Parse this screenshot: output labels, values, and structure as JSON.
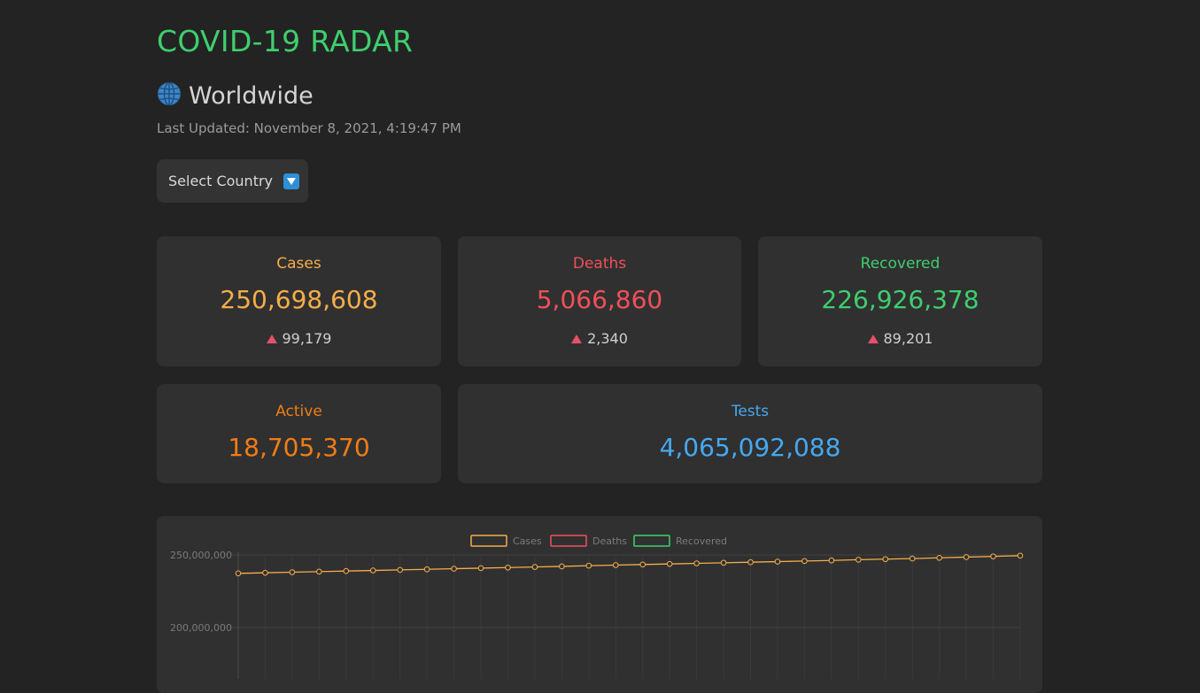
{
  "app": {
    "title": "COVID-19 RADAR"
  },
  "region": {
    "name": "Worldwide",
    "icon": "globe-icon"
  },
  "last_updated": "Last Updated: November 8, 2021, 4:19:47 PM",
  "country_select": {
    "label": "Select Country",
    "icon": "dropdown-arrow-icon"
  },
  "colors": {
    "accent": "#3ecf6e",
    "cases": "#f6ad4a",
    "deaths": "#f0505a",
    "recovered": "#3ecf6e",
    "active": "#f07c15",
    "tests": "#46a8f0",
    "delta_up": "#e8506a"
  },
  "stats": {
    "cases": {
      "label": "Cases",
      "value": "250,698,608",
      "delta": "99,179"
    },
    "deaths": {
      "label": "Deaths",
      "value": "5,066,860",
      "delta": "2,340"
    },
    "recovered": {
      "label": "Recovered",
      "value": "226,926,378",
      "delta": "89,201"
    },
    "active": {
      "label": "Active",
      "value": "18,705,370"
    },
    "tests": {
      "label": "Tests",
      "value": "4,065,092,088"
    }
  },
  "chart_data": {
    "type": "line",
    "legend": [
      "Cases",
      "Deaths",
      "Recovered"
    ],
    "legend_position": "top-center",
    "grid": true,
    "y_tick_labels": [
      "250,000,000",
      "200,000,000"
    ],
    "series": [
      {
        "name": "Cases",
        "color": "#f6ad4a",
        "values": [
          237300000,
          237700000,
          238100000,
          238500000,
          238900000,
          239300000,
          239700000,
          240100000,
          240500000,
          240900000,
          241300000,
          241700000,
          242100000,
          242600000,
          243000000,
          243400000,
          243800000,
          244200000,
          244600000,
          245000000,
          245400000,
          245800000,
          246200000,
          246700000,
          247100000,
          247500000,
          248000000,
          248500000,
          249000000,
          249500000
        ]
      }
    ]
  }
}
